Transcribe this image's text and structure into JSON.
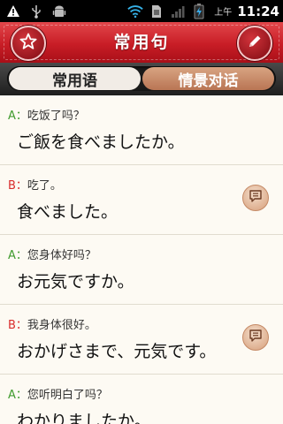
{
  "status_bar": {
    "ampm": "上午",
    "time": "11:24"
  },
  "header": {
    "title": "常用句"
  },
  "tabs": [
    {
      "label": "常用语",
      "active": false
    },
    {
      "label": "情景对话",
      "active": true
    }
  ],
  "items": [
    {
      "speaker": "A：",
      "chinese": "吃饭了吗？",
      "japanese": "ご飯を食べましたか。",
      "has_dialog_icon": false
    },
    {
      "speaker": "B：",
      "chinese": "吃了。",
      "japanese": "食べました。",
      "has_dialog_icon": true
    },
    {
      "speaker": "A：",
      "chinese": "您身体好吗？",
      "japanese": "お元気ですか。",
      "has_dialog_icon": false
    },
    {
      "speaker": "B：",
      "chinese": "我身体很好。",
      "japanese": "おかげさまで、元気です。",
      "has_dialog_icon": true
    },
    {
      "speaker": "A：",
      "chinese": "您听明白了吗？",
      "japanese": "わかりましたか。",
      "has_dialog_icon": false
    }
  ],
  "colors": {
    "header_red": "#c81d26",
    "speaker_a": "#3f9b2e",
    "speaker_b": "#d92c2c",
    "active_tab": "#c98a68"
  }
}
